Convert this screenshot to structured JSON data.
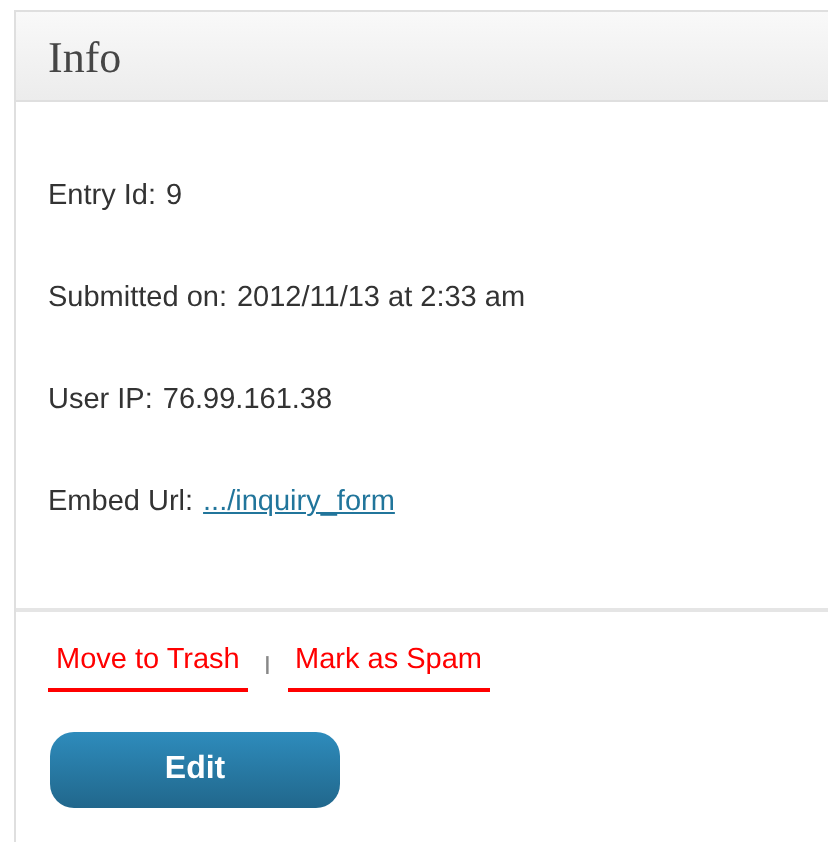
{
  "panel": {
    "title": "Info"
  },
  "fields": [
    {
      "kind": "text",
      "label": "Entry Id:",
      "value": "9"
    },
    {
      "kind": "text",
      "label": "Submitted on:",
      "value": "2012/11/13 at 2:33 am"
    },
    {
      "kind": "text",
      "label": "User IP:",
      "value": "76.99.161.38"
    },
    {
      "kind": "link",
      "label": "Embed Url:",
      "value": ".../inquiry_form"
    }
  ],
  "actions": [
    {
      "label": "Move to Trash"
    },
    {
      "label": "Mark as Spam"
    }
  ],
  "separator": "I",
  "button": {
    "label": "Edit"
  }
}
